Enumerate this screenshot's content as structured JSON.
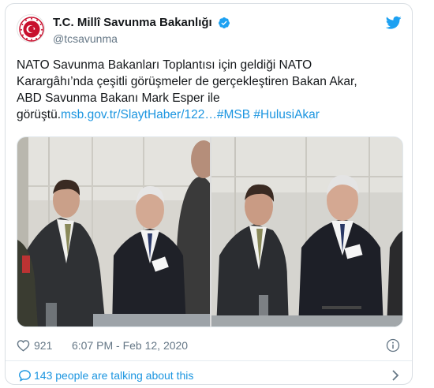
{
  "account": {
    "display_name": "T.C. Millî Savunma Bakanlığı",
    "handle": "@tcsavunma",
    "verified": true
  },
  "tweet": {
    "text_lines": [
      "NATO Savunma Bakanları Toplantısı için geldiği NATO",
      "Karargâhı’nda çeşitli görüşmeler de gerçekleştiren Bakan Akar,",
      "ABD Savunma Bakanı Mark Esper ile"
    ],
    "last_line_prefix": "görüştü.",
    "link": "msb.gov.tr/SlaytHaber/122…",
    "hashtag_1": "#MSB",
    "hashtag_2": "#HulusiAkar"
  },
  "meta": {
    "like_count": "921",
    "timestamp": "6:07 PM - Feb 12, 2020"
  },
  "conversation": {
    "label": "143 people are talking about this"
  },
  "colors": {
    "accent": "#1b95e0",
    "secondary_text": "#657786",
    "twitter_blue": "#1da1f2",
    "verified": "#1da1f2"
  },
  "icons": {
    "avatar": "msb-emblem-icon",
    "logo": "twitter-bird-icon",
    "like": "heart-icon",
    "info": "info-icon",
    "conversation": "speech-bubble-icon",
    "chevron": "chevron-right-icon"
  }
}
